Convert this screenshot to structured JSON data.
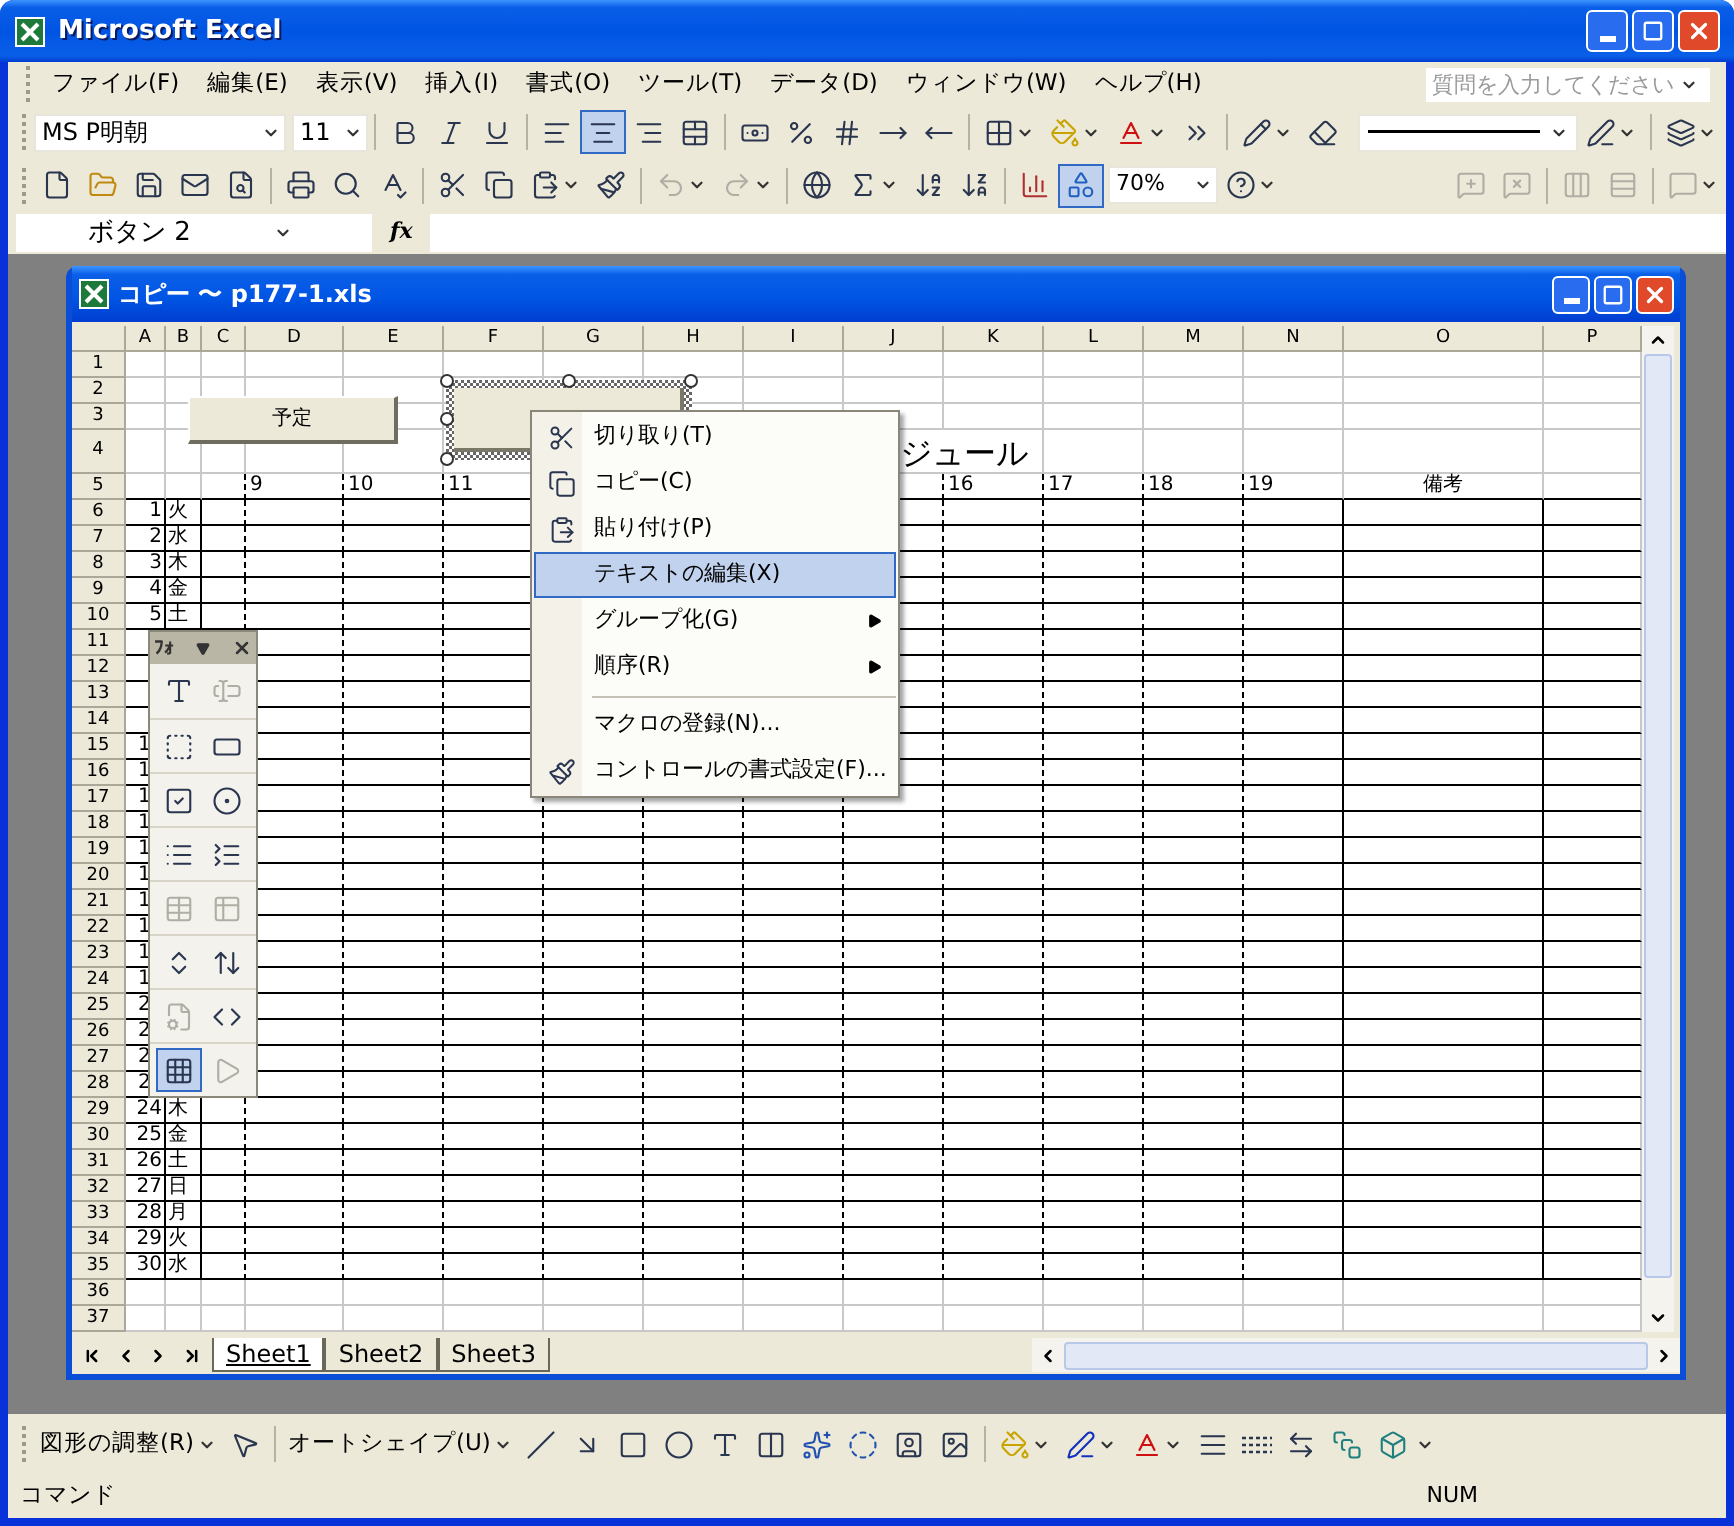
{
  "window": {
    "title": "Microsoft Excel"
  },
  "menu": [
    "ファイル(F)",
    "編集(E)",
    "表示(V)",
    "挿入(I)",
    "書式(O)",
    "ツール(T)",
    "データ(D)",
    "ウィンドウ(W)",
    "ヘルプ(H)"
  ],
  "help_box": {
    "placeholder": "質問を入力してください"
  },
  "format_toolbar": {
    "font": "MS P明朝",
    "size": "11",
    "align": [
      {
        "selected": false
      },
      {
        "selected": true
      },
      {
        "selected": false
      }
    ]
  },
  "standard_toolbar": {
    "drawing_toggle": {
      "selected": true
    },
    "zoom": "70%"
  },
  "formula_bar": {
    "name_box": "ボタン 2",
    "fx": "fx"
  },
  "workbook": {
    "title": "コピー 〜 p177-1.xls",
    "columns": [
      "A",
      "B",
      "C",
      "D",
      "E",
      "F",
      "G",
      "H",
      "I",
      "J",
      "K",
      "L",
      "M",
      "N",
      "O",
      "P"
    ],
    "rows": [
      {
        "number": "1"
      },
      {
        "number": "2"
      },
      {
        "number": "3"
      },
      {
        "number": "4",
        "title": "ジュール"
      },
      {
        "number": "5",
        "hours": {
          "D": "9",
          "E": "10",
          "F": "11",
          "K": "16",
          "L": "17",
          "M": "18",
          "N": "19"
        },
        "note_header": "備考"
      },
      {
        "number": "6",
        "day": "1",
        "weekday": "火",
        "cut": false
      },
      {
        "number": "7",
        "day": "2",
        "weekday": "水",
        "cut": false
      },
      {
        "number": "8",
        "day": "3",
        "weekday": "木",
        "cut": false
      },
      {
        "number": "9",
        "day": "4",
        "weekday": "金",
        "cut": false
      },
      {
        "number": "10",
        "day": "5",
        "weekday": "土",
        "cut": false
      },
      {
        "number": "11"
      },
      {
        "number": "12"
      },
      {
        "number": "13"
      },
      {
        "number": "14"
      },
      {
        "number": "15",
        "day": "1",
        "cut": true
      },
      {
        "number": "16",
        "day": "1",
        "cut": true
      },
      {
        "number": "17",
        "day": "1",
        "cut": true
      },
      {
        "number": "18",
        "day": "1",
        "cut": true
      },
      {
        "number": "19",
        "day": "1",
        "cut": true
      },
      {
        "number": "20",
        "day": "1",
        "cut": true
      },
      {
        "number": "21",
        "day": "1",
        "cut": true
      },
      {
        "number": "22",
        "day": "1",
        "cut": true
      },
      {
        "number": "23",
        "day": "1",
        "cut": true
      },
      {
        "number": "24",
        "day": "1",
        "cut": true
      },
      {
        "number": "25",
        "day": "2",
        "cut": true
      },
      {
        "number": "26",
        "day": "2",
        "cut": true
      },
      {
        "number": "27",
        "day": "2",
        "cut": true
      },
      {
        "number": "28",
        "day": "2",
        "cut": true
      },
      {
        "number": "29",
        "day": "24",
        "weekday": "木",
        "cut": false
      },
      {
        "number": "30",
        "day": "25",
        "weekday": "金",
        "cut": false
      },
      {
        "number": "31",
        "day": "26",
        "weekday": "土",
        "cut": false
      },
      {
        "number": "32",
        "day": "27",
        "weekday": "日",
        "cut": false
      },
      {
        "number": "33",
        "day": "28",
        "weekday": "月",
        "cut": false
      },
      {
        "number": "34",
        "day": "29",
        "weekday": "火",
        "cut": false
      },
      {
        "number": "35",
        "day": "30",
        "weekday": "水",
        "cut": false
      },
      {
        "number": "36"
      },
      {
        "number": "37"
      }
    ],
    "objects": [
      {
        "kind": "button",
        "label": "予定",
        "selected": false
      },
      {
        "kind": "button",
        "selected": true
      }
    ]
  },
  "context_menu": [
    {
      "label": "切り取り(T)",
      "selected": false,
      "submenu": false,
      "separator_before": false
    },
    {
      "label": "コピー(C)",
      "selected": false,
      "submenu": false,
      "separator_before": false
    },
    {
      "label": "貼り付け(P)",
      "selected": false,
      "submenu": false,
      "separator_before": false
    },
    {
      "label": "テキストの編集(X)",
      "selected": true,
      "submenu": false,
      "separator_before": false
    },
    {
      "label": "グループ化(G)",
      "selected": false,
      "submenu": true,
      "separator_before": false
    },
    {
      "label": "順序(R)",
      "selected": false,
      "submenu": true,
      "separator_before": false
    },
    {
      "label": "マクロの登録(N)...",
      "selected": false,
      "submenu": false,
      "separator_before": true
    },
    {
      "label": "コントロールの書式設定(F)...",
      "selected": false,
      "submenu": false,
      "separator_before": false
    }
  ],
  "forms_toolbar": {
    "title": "ﾌｫ",
    "grid_toggle": {
      "selected": true
    },
    "controls": [
      {
        "disabled": false
      },
      {
        "disabled": true
      },
      {
        "disabled": false
      },
      {
        "disabled": false
      },
      {
        "disabled": false
      },
      {
        "disabled": false
      },
      {
        "disabled": false
      },
      {
        "disabled": false
      },
      {
        "disabled": true
      },
      {
        "disabled": true
      },
      {
        "disabled": false
      },
      {
        "disabled": false
      },
      {
        "disabled": true
      },
      {
        "disabled": false
      },
      {
        "disabled": false
      },
      {
        "disabled": true
      }
    ]
  },
  "sheet_tabs": [
    {
      "label": "Sheet1",
      "selected": true
    },
    {
      "label": "Sheet2",
      "selected": false
    },
    {
      "label": "Sheet3",
      "selected": false
    }
  ],
  "drawing_toolbar": {
    "draw_menu": "図形の調整(R)",
    "autoshapes": "オートシェイプ(U)"
  },
  "status_bar": {
    "mode": "コマンド",
    "num": "NUM"
  }
}
